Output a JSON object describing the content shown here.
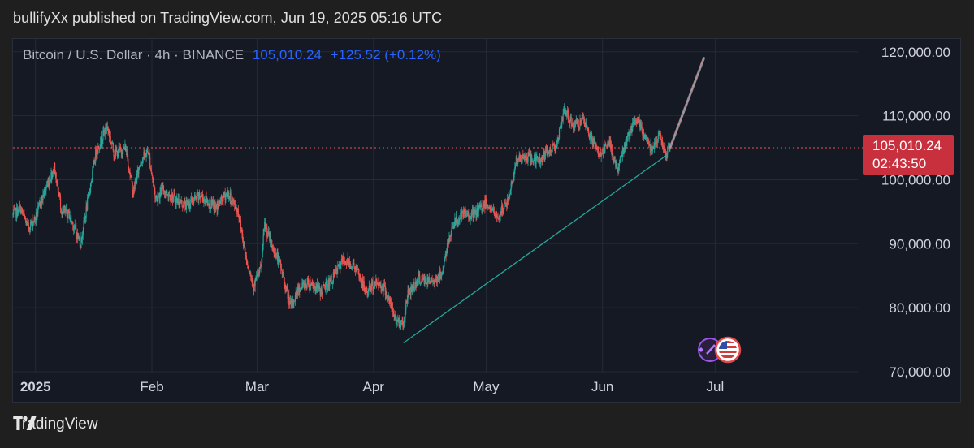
{
  "header": {
    "text": "bullifyXx published on TradingView.com, Jun 19, 2025 05:16 UTC"
  },
  "legend": {
    "symbol": "Bitcoin / U.S. Dollar · 4h · BINANCE",
    "price": "105,010.24",
    "change": "+125.52 (+0.12%)"
  },
  "price_tag": {
    "price": "105,010.24",
    "countdown": "02:43:50"
  },
  "footer": {
    "brand": "TradingView"
  },
  "colors": {
    "up": "#26a69a",
    "down": "#ef5350",
    "trendline": "#26a69a",
    "price_line": "#ef5350",
    "tag": "#c9303d",
    "legend_accent": "#2962ff"
  },
  "icons": [
    "tradingview-logo-icon",
    "sparkle-icon",
    "us-flag-icon"
  ],
  "chart_data": {
    "type": "candlestick",
    "title": "",
    "xlabel": "",
    "ylabel": "",
    "ylim": [
      70000,
      122000
    ],
    "yticks": [
      70000,
      80000,
      90000,
      100000,
      110000,
      120000
    ],
    "ytick_labels": [
      "70,000.00",
      "80,000.00",
      "90,000.00",
      "100,000.00",
      "110,000.00",
      "120,000.00"
    ],
    "xtick_labels": [
      "2025",
      "Feb",
      "Mar",
      "Apr",
      "May",
      "Jun",
      "Jul"
    ],
    "xticks": [
      "2025-01-01",
      "2025-02-01",
      "2025-03-01",
      "2025-04-01",
      "2025-05-01",
      "2025-06-01",
      "2025-07-01"
    ],
    "xlim": [
      "2024-12-26",
      "2025-08-08"
    ],
    "grid": true,
    "price_path": [
      [
        "2024-12-26",
        94500
      ],
      [
        "2024-12-28",
        95500
      ],
      [
        "2024-12-30",
        92500
      ],
      [
        "2025-01-01",
        94000
      ],
      [
        "2025-01-03",
        97500
      ],
      [
        "2025-01-06",
        102000
      ],
      [
        "2025-01-08",
        95000
      ],
      [
        "2025-01-10",
        94500
      ],
      [
        "2025-01-13",
        90000
      ],
      [
        "2025-01-15",
        97000
      ],
      [
        "2025-01-17",
        104000
      ],
      [
        "2025-01-20",
        108500
      ],
      [
        "2025-01-22",
        104000
      ],
      [
        "2025-01-25",
        105000
      ],
      [
        "2025-01-27",
        98000
      ],
      [
        "2025-01-29",
        103000
      ],
      [
        "2025-01-31",
        104500
      ],
      [
        "2025-02-02",
        97000
      ],
      [
        "2025-02-04",
        98500
      ],
      [
        "2025-02-07",
        97000
      ],
      [
        "2025-02-10",
        96000
      ],
      [
        "2025-02-14",
        97500
      ],
      [
        "2025-02-18",
        95500
      ],
      [
        "2025-02-21",
        98000
      ],
      [
        "2025-02-24",
        95000
      ],
      [
        "2025-02-26",
        88000
      ],
      [
        "2025-02-28",
        83500
      ],
      [
        "2025-03-02",
        86000
      ],
      [
        "2025-03-03",
        93000
      ],
      [
        "2025-03-05",
        89500
      ],
      [
        "2025-03-07",
        87000
      ],
      [
        "2025-03-10",
        80000
      ],
      [
        "2025-03-12",
        83000
      ],
      [
        "2025-03-15",
        84000
      ],
      [
        "2025-03-18",
        82500
      ],
      [
        "2025-03-21",
        84500
      ],
      [
        "2025-03-24",
        87500
      ],
      [
        "2025-03-27",
        86500
      ],
      [
        "2025-03-30",
        82500
      ],
      [
        "2025-04-02",
        84000
      ],
      [
        "2025-04-04",
        83000
      ],
      [
        "2025-04-07",
        78000
      ],
      [
        "2025-04-09",
        77500
      ],
      [
        "2025-04-10",
        82000
      ],
      [
        "2025-04-13",
        84500
      ],
      [
        "2025-04-16",
        84000
      ],
      [
        "2025-04-19",
        85000
      ],
      [
        "2025-04-22",
        93000
      ],
      [
        "2025-04-25",
        94500
      ],
      [
        "2025-04-28",
        94500
      ],
      [
        "2025-05-01",
        96500
      ],
      [
        "2025-05-04",
        94000
      ],
      [
        "2025-05-07",
        97000
      ],
      [
        "2025-05-09",
        103000
      ],
      [
        "2025-05-12",
        103500
      ],
      [
        "2025-05-15",
        103000
      ],
      [
        "2025-05-18",
        104500
      ],
      [
        "2025-05-20",
        106000
      ],
      [
        "2025-05-22",
        111000
      ],
      [
        "2025-05-24",
        108500
      ],
      [
        "2025-05-27",
        109000
      ],
      [
        "2025-05-29",
        106500
      ],
      [
        "2025-05-31",
        104000
      ],
      [
        "2025-06-03",
        105500
      ],
      [
        "2025-06-05",
        101500
      ],
      [
        "2025-06-07",
        105500
      ],
      [
        "2025-06-10",
        109500
      ],
      [
        "2025-06-12",
        107000
      ],
      [
        "2025-06-14",
        105000
      ],
      [
        "2025-06-16",
        107000
      ],
      [
        "2025-06-18",
        104000
      ],
      [
        "2025-06-19",
        105010
      ]
    ],
    "last_price": 105010.24,
    "annotations": [
      {
        "type": "trendline",
        "from": [
          "2025-04-09",
          74500
        ],
        "to": [
          "2025-06-18",
          103800
        ]
      },
      {
        "type": "projection",
        "from": [
          "2025-06-19",
          105000
        ],
        "to": [
          "2025-06-28",
          119000
        ]
      },
      {
        "type": "price_line",
        "value": 105010.24
      }
    ]
  }
}
